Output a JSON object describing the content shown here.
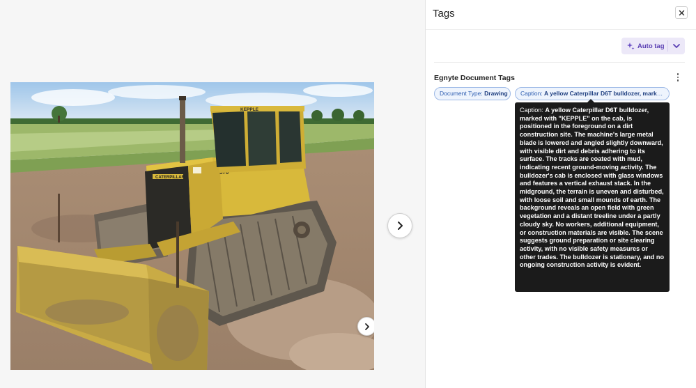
{
  "panel": {
    "title": "Tags",
    "auto_tag_label": "Auto tag",
    "section_title": "Egnyte Document Tags"
  },
  "tags": [
    {
      "label": "Document Type:",
      "value": "Drawing"
    },
    {
      "label": "Caption:",
      "value": "A yellow Caterpillar D6T bulldozer, marked..."
    }
  ],
  "tooltip": {
    "label": "Caption:",
    "text": "A yellow Caterpillar D6T bulldozer, marked with \"KEPPLE\" on the cab, is positioned in the foreground on a dirt construction site. The machine's large metal blade is lowered and angled slightly downward, with visible dirt and debris adhering to its surface. The tracks are coated with mud, indicating recent ground-moving activity. The bulldozer's cab is enclosed with glass windows and features a vertical exhaust stack. In the midground, the terrain is uneven and disturbed, with loose soil and small mounds of earth. The background reveals an open field with green vegetation and a distant treeline under a partly cloudy sky. No workers, additional equipment, or construction materials are visible. The scene suggests ground preparation or site clearing activity, with no visible safety measures or other trades. The bulldozer is stationary, and no ongoing construction activity is evident."
  },
  "photo": {
    "cab_brand": "KEPPLE",
    "body_brand": "CATERPILLAR",
    "unit_number": "570"
  },
  "icons": {
    "close": "close-icon",
    "auto_tag": "sparkle-icon",
    "caret": "chevron-down-icon",
    "more": "kebab-icon",
    "next_image": "chevron-right-icon",
    "next_document": "chevron-right-icon"
  },
  "colors": {
    "accent": "#5a3fb3",
    "chip_border": "#9db9e6",
    "chip_bg": "#eef4fd",
    "tooltip_bg": "#1b1b1b"
  }
}
